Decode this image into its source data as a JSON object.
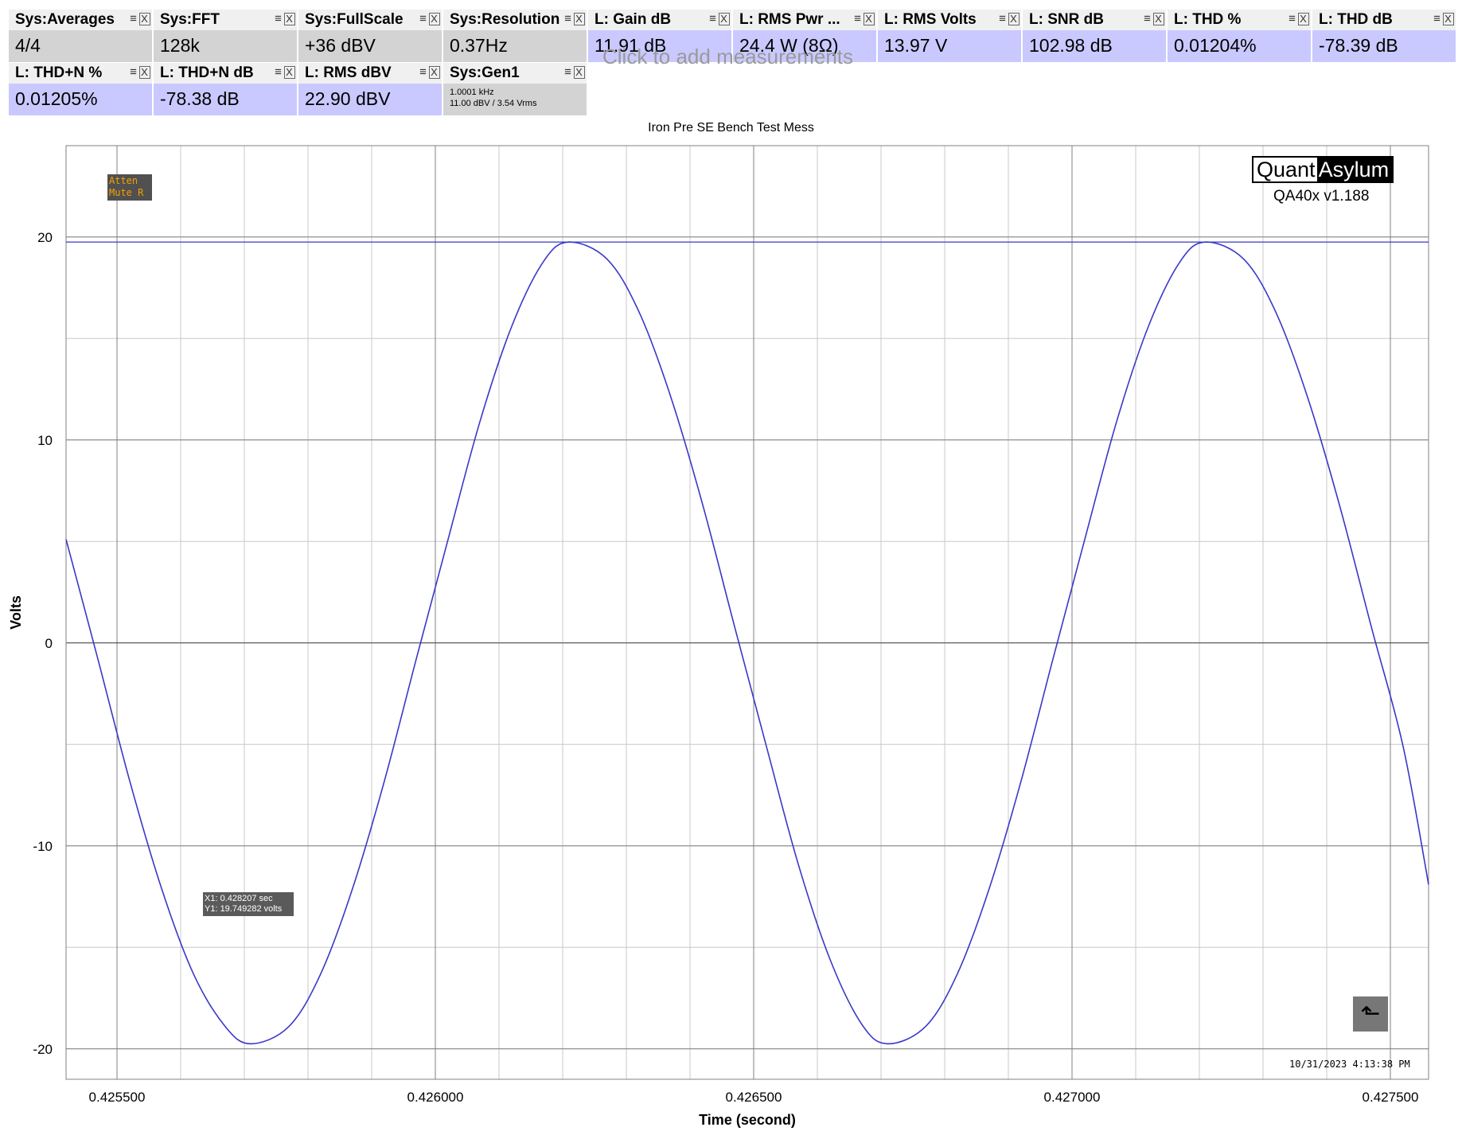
{
  "measurements": [
    {
      "label": "Sys:Averages",
      "value": "4/4",
      "kind": "sys"
    },
    {
      "label": "Sys:FFT",
      "value": "128k",
      "kind": "sys"
    },
    {
      "label": "Sys:FullScale",
      "value": "+36 dBV",
      "kind": "sys"
    },
    {
      "label": "Sys:Resolution",
      "value": "0.37Hz",
      "kind": "sys"
    },
    {
      "label": "L: Gain dB",
      "value": "11.91 dB",
      "kind": "meas"
    },
    {
      "label": "L: RMS Pwr ...",
      "value": "24.4 W (8Ω)",
      "kind": "meas"
    },
    {
      "label": "L: RMS Volts",
      "value": "13.97 V",
      "kind": "meas"
    },
    {
      "label": "L: SNR dB",
      "value": "102.98 dB",
      "kind": "meas"
    },
    {
      "label": "L: THD %",
      "value": "0.01204%",
      "kind": "meas"
    },
    {
      "label": "L: THD dB",
      "value": "-78.39 dB",
      "kind": "meas"
    },
    {
      "label": "L: THD+N %",
      "value": "0.01205%",
      "kind": "meas"
    },
    {
      "label": "L: THD+N dB",
      "value": "-78.38 dB",
      "kind": "meas"
    },
    {
      "label": "L: RMS dBV",
      "value": "22.90 dBV",
      "kind": "meas"
    }
  ],
  "generator": {
    "label": "Sys:Gen1",
    "line1": "1.0001 kHz",
    "line2": "11.00 dBV  / 3.54 Vrms"
  },
  "tile_controls": {
    "menu": "≡",
    "close": "X"
  },
  "add_measurements_hint": "Click to add measurements",
  "badge": {
    "line1": "Atten",
    "line2": "Mute R"
  },
  "logo": {
    "part1": "Quant",
    "part2": "Asylum",
    "version": "QA40x v1.188"
  },
  "cursor_readout": {
    "x_line": "X1: 0.428207 sec",
    "y_line": "Y1: 19.749282 volts"
  },
  "back_button_icon": "return-arrow-icon",
  "timestamp": "10/31/2023 4:13:38 PM",
  "colors": {
    "trace": "#3838c8",
    "grid": "#c8c8c8",
    "measure_bg": "#c9c9ff",
    "sys_bg": "#d3d3d3"
  },
  "chart_data": {
    "type": "line",
    "title": "Iron Pre SE Bench Test Mess",
    "xlabel": "Time (second)",
    "ylabel": "Volts",
    "xlim": [
      0.42542,
      0.42756
    ],
    "ylim": [
      -21.5,
      24.5
    ],
    "x_ticks": [
      0.4255,
      0.426,
      0.4265,
      0.427,
      0.4275
    ],
    "x_tick_labels": [
      "0.425500",
      "0.426000",
      "0.426500",
      "0.427000",
      "0.427500"
    ],
    "y_ticks": [
      -20,
      -10,
      0,
      10,
      20
    ],
    "y_tick_labels": [
      "-20",
      "-10",
      "0",
      "10",
      "20"
    ],
    "grid": true,
    "series": [
      {
        "x": [
          0.42542,
          0.42547,
          0.42552,
          0.42557,
          0.42562,
          0.42567,
          0.42571,
          0.42577,
          0.42582,
          0.42587,
          0.42592,
          0.42597,
          0.42602,
          0.42607,
          0.42612,
          0.42617,
          0.42621,
          0.42627,
          0.42632,
          0.42637,
          0.42642,
          0.42647,
          0.42652,
          0.42657,
          0.42662,
          0.42667,
          0.42671,
          0.42677,
          0.42682,
          0.42687,
          0.42692,
          0.42697,
          0.42702,
          0.42707,
          0.42712,
          0.42717,
          0.42721,
          0.42727,
          0.42732,
          0.42737,
          0.42742,
          0.42747,
          0.42752,
          0.42756
        ],
        "y": [
          5.1,
          -0.8,
          -6.8,
          -12.1,
          -16.3,
          -18.9,
          -19.75,
          -18.9,
          -16.3,
          -12.1,
          -6.8,
          -0.8,
          5.1,
          10.9,
          15.6,
          18.8,
          19.75,
          18.9,
          16.3,
          12.1,
          6.8,
          0.8,
          -5.1,
          -10.9,
          -15.6,
          -18.8,
          -19.75,
          -18.9,
          -16.3,
          -12.1,
          -6.8,
          -0.8,
          5.1,
          10.9,
          15.6,
          18.8,
          19.75,
          18.9,
          16.3,
          12.1,
          6.8,
          0.8,
          -5.1,
          -11.9
        ]
      }
    ],
    "reference_line_y": 19.749282
  }
}
